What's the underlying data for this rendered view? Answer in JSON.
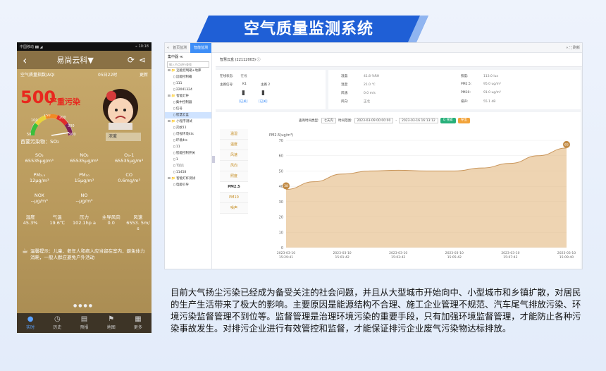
{
  "banner": {
    "title": "空气质量监测系统"
  },
  "phone": {
    "status_left": "中国移动 ▮▮ ◢",
    "status_right": "⌁ 10:18",
    "nav": {
      "title": "易尚云科▼"
    },
    "aqi_label": "空气质量指数/AQI",
    "time": "05日22时",
    "update": "更新",
    "aqi_value": "500",
    "aqi_level": "严重污染",
    "gauge_labels": [
      "50",
      "100",
      "150",
      "200",
      "300",
      "500"
    ],
    "concentration_label": "浓度",
    "primary_pollutant": "首要污染物：SO₂",
    "rows": [
      [
        {
          "name": "SO₂",
          "value": "65535μg/m³"
        },
        {
          "name": "NO₂",
          "value": "65535μg/m³"
        },
        {
          "name": "O₃-1",
          "value": "65535μg/m³"
        }
      ],
      [
        {
          "name": "PM₂.₅",
          "value": "12μg/m³"
        },
        {
          "name": "PM₁₀",
          "value": "15μg/m³"
        },
        {
          "name": "CO",
          "value": "0.6mg/m³"
        }
      ],
      [
        {
          "name": "NOX",
          "value": "--μg/m³"
        },
        {
          "name": "NO",
          "value": "--μg/m³"
        },
        {
          "name": "",
          "value": ""
        }
      ]
    ],
    "weather": [
      {
        "name": "湿度",
        "value": "45.3%"
      },
      {
        "name": "气温",
        "value": "19.6℃"
      },
      {
        "name": "压力",
        "value": "102.1hp a"
      },
      {
        "name": "主导风向",
        "value": "0.0"
      },
      {
        "name": "风速",
        "value": "6553. 5m/ s"
      }
    ],
    "tip": "温馨提示：儿童、老年人和病人应当留在室内，避免体力消耗，一般人群应避免户外活动",
    "dots": "●●●●",
    "tabs": [
      {
        "icon": "●",
        "label": "实时"
      },
      {
        "icon": "◷",
        "label": "历史"
      },
      {
        "icon": "▤",
        "label": "预报"
      },
      {
        "icon": "⚑",
        "label": "地图"
      },
      {
        "icon": "▦",
        "label": "更多"
      }
    ]
  },
  "web": {
    "tabs": [
      "首页监测",
      "智能监测"
    ],
    "top_right": "» ⛶ 刷新",
    "sidebar_title": "集中器 ≪",
    "search_placeholder": "输入节点进行查找",
    "tree": [
      {
        "label": "⊟ 📁 迈能控制箱+地库",
        "indent": 0
      },
      {
        "label": "▯ 迈能控制箱",
        "indent": 1
      },
      {
        "label": "▯ 111",
        "indent": 1
      },
      {
        "label": "▯ 22041324",
        "indent": 1
      },
      {
        "label": "⊟ 📁 智能灯杆",
        "indent": 0
      },
      {
        "label": "▯ 集中控制器",
        "indent": 1
      },
      {
        "label": "▯ 信号",
        "indent": 1
      },
      {
        "label": "▯ 智慧云盒",
        "indent": 1,
        "sel": true
      },
      {
        "label": "⊟ 📁 小程序测试",
        "indent": 0
      },
      {
        "label": "▯ 灭蚊11",
        "indent": 1
      },
      {
        "label": "▯ 可视环境4ts",
        "indent": 1
      },
      {
        "label": "▯ 环境4ts",
        "indent": 1
      },
      {
        "label": "▯ 11",
        "indent": 1
      },
      {
        "label": "▯ 智能控制开关",
        "indent": 1
      },
      {
        "label": "▯ 1",
        "indent": 1
      },
      {
        "label": "▯ T111",
        "indent": 1
      },
      {
        "label": "▯ 11458",
        "indent": 1
      },
      {
        "label": "⊟ 📁 智能灯杆测试",
        "indent": 0
      },
      {
        "label": "▯ 电能引导",
        "indent": 1
      }
    ],
    "header": "智慧云盒 (22112003)",
    "info_left": {
      "status_label": "在线状态:",
      "status_value": "在线",
      "switch_label": "主路信号:",
      "k1": "K1",
      "k2": "主路 2",
      "btn1": "[已关]",
      "btn2": "[已关]"
    },
    "info_right": [
      {
        "k": "湿度:",
        "v": "41.8 %RH"
      },
      {
        "k": "照度:",
        "v": "113.0 lux"
      },
      {
        "k": "温度:",
        "v": "21.0 ℃"
      },
      {
        "k": "PM2.5:",
        "v": "95.0 ug/m³"
      },
      {
        "k": "风速:",
        "v": "0.0 m/s"
      },
      {
        "k": "PM10:",
        "v": "91.0 ug/m³"
      },
      {
        "k": "风向:",
        "v": "正北"
      },
      {
        "k": "噪声:",
        "v": "55.1 dB"
      }
    ],
    "filter": {
      "label1": "查询时间类型:",
      "type": "七天内",
      "label2": "时间范围:",
      "start": "2023-03-09 00:00:00",
      "sep": "-",
      "end": "2023-03-16 16:13:12",
      "search": "Q 搜索",
      "export": "导出"
    },
    "vtabs": [
      "温湿",
      "温度",
      "风速",
      "风向",
      "照度",
      "PM2.5",
      "PM10",
      "噪声"
    ],
    "vtab_active": "PM2.5"
  },
  "chart_data": {
    "type": "area",
    "ylabel": "PM2.5(ug/m³)",
    "ylim": [
      0,
      70
    ],
    "yticks": [
      0,
      10,
      20,
      30,
      40,
      50,
      60,
      70
    ],
    "x": [
      "2023-03-10\n15:29:41",
      "2023-03-10\n15:01:42",
      "2023-03-10\n15:03:42",
      "2023-03-10\n15:05:42",
      "2023-03-10\n15:07:42",
      "2023-03-10\n15:09:40"
    ],
    "series": [
      {
        "values": [
          38,
          43,
          48,
          50,
          50.5,
          50,
          50,
          52,
          55,
          60,
          65
        ]
      }
    ],
    "start_marker": "38",
    "end_marker": "65",
    "color": "#e3b77f"
  },
  "paragraph": "目前大气扬尘污染已经成为备受关注的社会问题，并且从大型城市开始向中、小型城市和乡镇扩散，对居民的生产生活带来了极大的影响。主要原因是能源结构不合理、施工企业管理不规范、汽车尾气排放污染、环境污染监督管理不到位等。监督管理是治理环境污染的重要手段，只有加强环境监督管理，才能防止各种污染事故发生。对排污企业进行有效管控和监督，才能保证排污企业废气污染物达标排放。"
}
